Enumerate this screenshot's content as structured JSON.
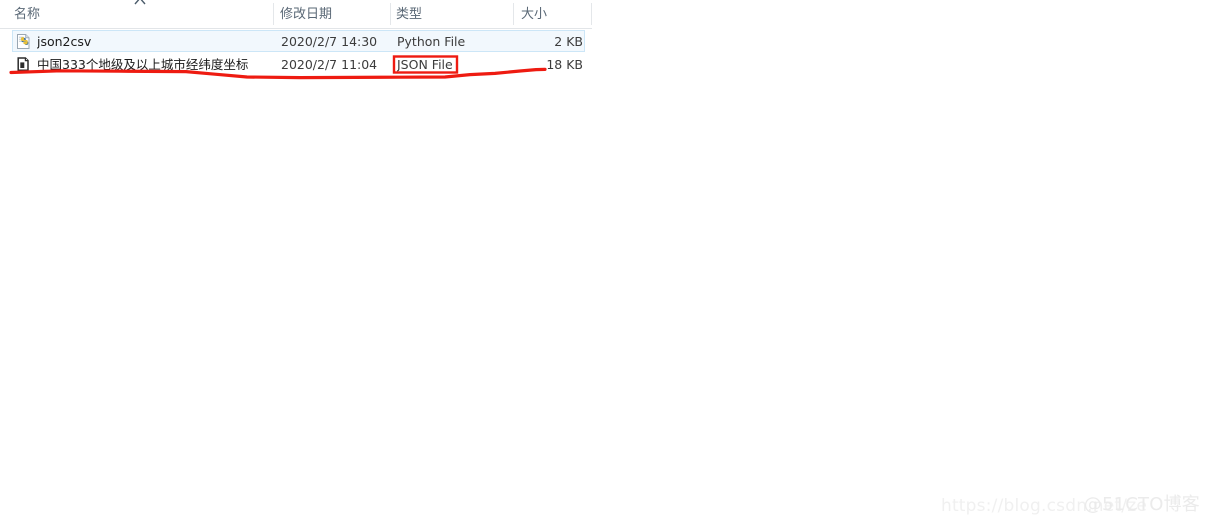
{
  "file_list": {
    "columns": [
      {
        "key": "name",
        "label": "名称"
      },
      {
        "key": "date",
        "label": "修改日期"
      },
      {
        "key": "type",
        "label": "类型"
      },
      {
        "key": "size",
        "label": "大小"
      }
    ],
    "sort": {
      "column": "名称",
      "direction": "ascending",
      "indicator_icon": "caret-up-icon"
    },
    "rows": [
      {
        "name": "json2csv",
        "date": "2020/2/7 14:30",
        "type": "Python File",
        "size": "2 KB",
        "icon": "python-file-icon",
        "selected": true
      },
      {
        "name": "中国333个地级及以上城市经纬度坐标",
        "date": "2020/2/7 11:04",
        "type": "JSON File",
        "size": "18 KB",
        "icon": "json-file-icon",
        "selected": false
      }
    ]
  },
  "annotations": {
    "color": "#ee1b11",
    "highlight_box": {
      "target": "JSON File",
      "shape": "rectangle"
    },
    "underline": {
      "target": "中国333个地级及以上城市经纬度坐标 row",
      "shape": "freehand-line"
    }
  },
  "watermark": {
    "url_text": "https://blog.csdn.net/ze",
    "site_text": "@51CTO博客"
  },
  "colors": {
    "selection_fill": "#f2f8fd",
    "selection_border": "#cce6f7",
    "header_text": "#5a6876",
    "row_text": "#2d2d2d",
    "annotation_red": "#ee1b11"
  }
}
